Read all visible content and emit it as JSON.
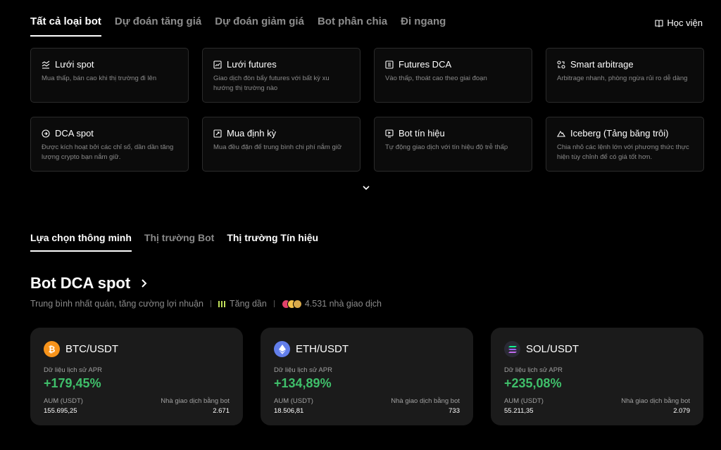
{
  "top_tabs": [
    {
      "label": "Tất cả loại bot"
    },
    {
      "label": "Dự đoán tăng giá"
    },
    {
      "label": "Dự đoán giảm giá"
    },
    {
      "label": "Bot phân chia"
    },
    {
      "label": "Đi ngang"
    }
  ],
  "academy": {
    "label": "Học viện",
    "icon": "book-icon"
  },
  "bot_types": [
    {
      "title": "Lưới spot",
      "desc": "Mua thấp, bán cao khi thị trường đi lên",
      "icon": "grid-chart-icon"
    },
    {
      "title": "Lưới futures",
      "desc": "Giao dịch đòn bẩy futures với bất kỳ xu hướng thị trường nào",
      "icon": "futures-chart-icon"
    },
    {
      "title": "Futures DCA",
      "desc": "Vào thấp, thoát cao theo giai đoạn",
      "icon": "futures-dca-icon"
    },
    {
      "title": "Smart arbitrage",
      "desc": "Arbitrage nhanh, phòng ngừa rủi ro dễ dàng",
      "icon": "arbitrage-icon"
    },
    {
      "title": "DCA spot",
      "desc": "Được kích hoạt bởi các chỉ số, dần dần tăng lượng crypto bạn nắm giữ.",
      "icon": "dca-icon"
    },
    {
      "title": "Mua định kỳ",
      "desc": "Mua đều đặn để trung bình chi phí nắm giữ",
      "icon": "recurring-buy-icon"
    },
    {
      "title": "Bot tín hiệu",
      "desc": "Tự động giao dịch với tín hiệu độ trễ thấp",
      "icon": "signal-icon"
    },
    {
      "title": "Iceberg (Tảng băng trôi)",
      "desc": "Chia nhỏ các lệnh lớn với phương thức thực hiện tùy chỉnh để có giá tốt hơn.",
      "icon": "iceberg-icon"
    }
  ],
  "section_tabs": [
    {
      "label": "Lựa chọn thông minh"
    },
    {
      "label": "Thị trường Bot"
    },
    {
      "label": "Thị trường Tín hiệu"
    }
  ],
  "section": {
    "title": "Bot DCA spot",
    "subtitle": "Trung bình nhất quán, tăng cường lợi nhuận",
    "trend": "Tăng dần",
    "traders": "4.531 nhà giao dịch"
  },
  "pairs": [
    {
      "name": "BTC/USDT",
      "coin_color": "#f7931a",
      "apr_label": "Dữ liệu lịch sử APR",
      "apr": "+179,45%",
      "aum_label": "AUM (USDT)",
      "aum": "155.695,25",
      "traders_label": "Nhà giao dịch bằng bot",
      "traders": "2.671"
    },
    {
      "name": "ETH/USDT",
      "coin_color": "#627eea",
      "apr_label": "Dữ liệu lịch sử APR",
      "apr": "+134,89%",
      "aum_label": "AUM (USDT)",
      "aum": "18.506,81",
      "traders_label": "Nhà giao dịch bằng bot",
      "traders": "733"
    },
    {
      "name": "SOL/USDT",
      "coin_color": "#2a2a35",
      "apr_label": "Dữ liệu lịch sử APR",
      "apr": "+235,08%",
      "aum_label": "AUM (USDT)",
      "aum": "55.211,35",
      "traders_label": "Nhà giao dịch bằng bot",
      "traders": "2.079"
    }
  ],
  "colors": {
    "accent_green": "#3fbf6a",
    "background": "#000000",
    "card": "#1b1b1b"
  }
}
